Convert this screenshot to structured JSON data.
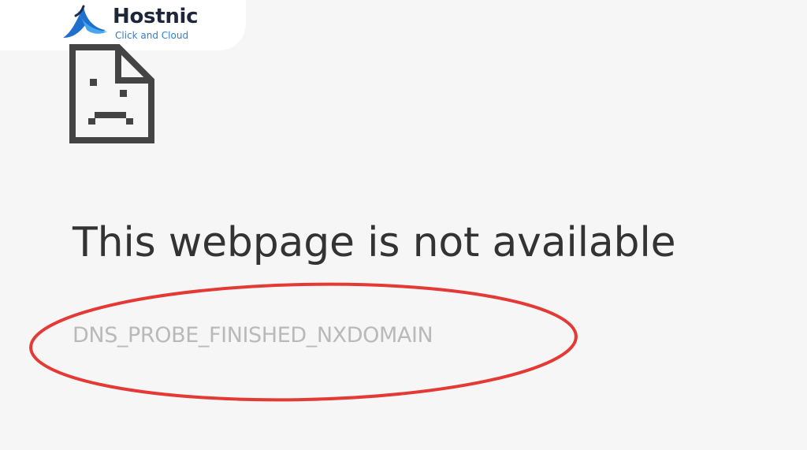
{
  "logo": {
    "name": "Hostnic",
    "tagline": "Click and Cloud",
    "mark_icon": "wave-swoosh-icon",
    "brand_color": "#1d2739",
    "accent_color": "#2f7fd1"
  },
  "error_page": {
    "icon": "sad-page-icon",
    "title": "This webpage is not available",
    "error_code": "DNS_PROBE_FINISHED_NXDOMAIN"
  },
  "annotation": {
    "shape": "ellipse",
    "color": "#e53935",
    "highlights": "error_code"
  }
}
